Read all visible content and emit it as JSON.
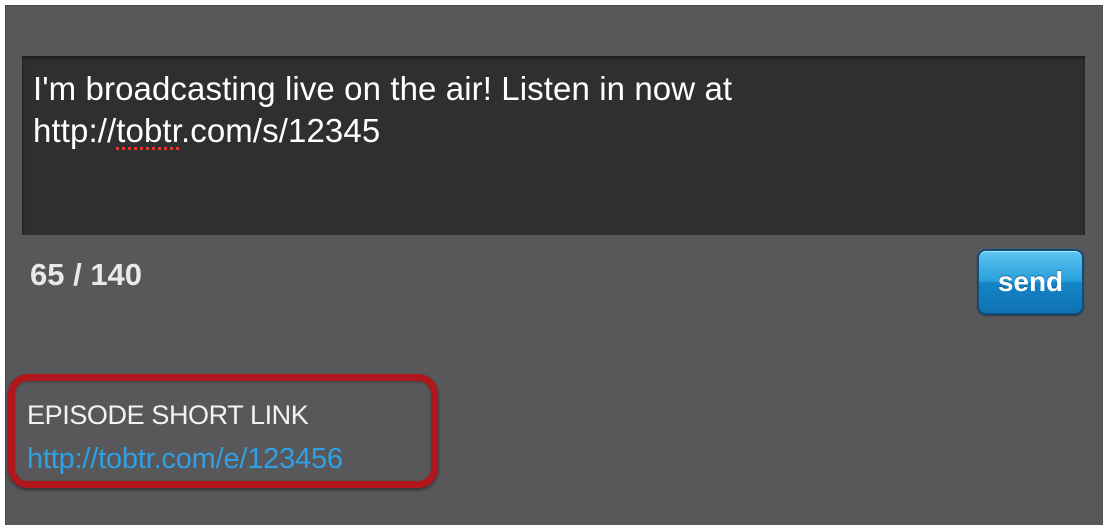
{
  "message": {
    "line1": "I'm broadcasting live on the air! Listen in now at",
    "line2_prefix": "http://",
    "line2_misspelled": "tobtr",
    "line2_suffix": ".com/s/12345"
  },
  "counter": {
    "text": "65 / 140"
  },
  "send_button": {
    "label": "send"
  },
  "episode_short_link": {
    "label": "EPISODE SHORT LINK",
    "url": "http://tobtr.com/e/123456"
  },
  "colors": {
    "panel_background": "#58585a",
    "textarea_background": "#2e2f31",
    "link_color": "#2fa0e4",
    "highlight_border": "#b0161b",
    "send_button_blue": "#1384c7"
  }
}
